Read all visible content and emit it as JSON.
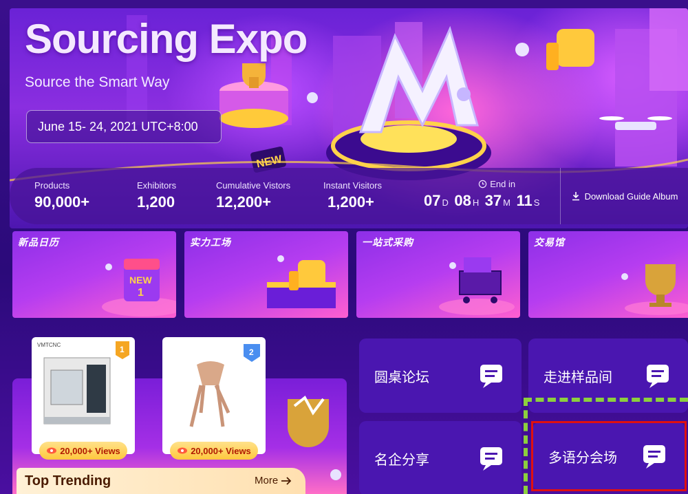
{
  "banner": {
    "title": "Sourcing Expo",
    "subtitle": "Source the Smart Way",
    "date": "June 15- 24, 2021 UTC+8:00",
    "stats": [
      {
        "label": "Products",
        "value": "90,000+"
      },
      {
        "label": "Exhibitors",
        "value": "1,200"
      },
      {
        "label": "Cumulative Vistors",
        "value": "12,200+"
      },
      {
        "label": "Instant Visitors",
        "value": "1,200+"
      }
    ],
    "countdown": {
      "label": "End  in",
      "days": "07",
      "days_unit": "D",
      "hours": "08",
      "hours_unit": "H",
      "minutes": "37",
      "minutes_unit": "M",
      "seconds": "11",
      "seconds_unit": "S"
    },
    "download_label": "Download Guide Album"
  },
  "zones": [
    {
      "title": "新品日历"
    },
    {
      "title": "实力工场"
    },
    {
      "title": "一站式采购"
    },
    {
      "title": "交易馆"
    }
  ],
  "trending": {
    "title": "Top Trending",
    "more_label": "More",
    "products": [
      {
        "rank": "1",
        "brand": "VMTCNC",
        "views": "20,000+ Views"
      },
      {
        "rank": "2",
        "views": "20,000+ Views"
      }
    ]
  },
  "halls": [
    {
      "label": "圆桌论坛"
    },
    {
      "label": "走进样品间"
    },
    {
      "label": "名企分享"
    },
    {
      "label": "多语分会场"
    }
  ],
  "colors": {
    "page_bg": "#2b0a7a",
    "hall_bg": "#4a16b0",
    "views_text": "#b01a00",
    "highlight_red": "#e01010",
    "highlight_green": "#8ccf3e"
  }
}
